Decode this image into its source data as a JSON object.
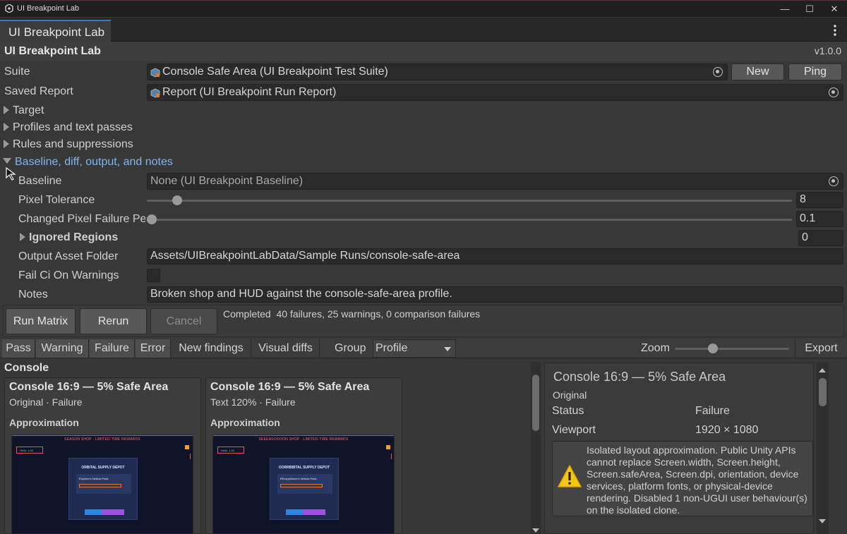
{
  "window": {
    "title": "UI Breakpoint Lab"
  },
  "tab": {
    "label": "UI Breakpoint Lab"
  },
  "header": {
    "title": "UI Breakpoint Lab",
    "version": "v1.0.0"
  },
  "suite": {
    "label": "Suite",
    "value": "Console Safe Area (UI Breakpoint Test Suite)",
    "new_label": "New",
    "ping_label": "Ping"
  },
  "saved_report": {
    "label": "Saved Report",
    "value": "Report (UI Breakpoint Run Report)"
  },
  "foldouts": {
    "target": "Target",
    "profiles": "Profiles and text passes",
    "rules": "Rules and suppressions",
    "baseline_section": "Baseline, diff, output, and notes"
  },
  "baseline": {
    "label": "Baseline",
    "value": "None (UI Breakpoint Baseline)"
  },
  "pixel_tolerance": {
    "label": "Pixel Tolerance",
    "value": "8",
    "fraction": 0.04
  },
  "changed_pixel": {
    "label": "Changed Pixel Failure Pe",
    "value": "0.1",
    "fraction": 0.0
  },
  "ignored_regions": {
    "label": "Ignored Regions",
    "count": "0"
  },
  "output_folder": {
    "label": "Output Asset Folder",
    "value": "Assets/UIBreakpointLabData/Sample Runs/console-safe-area"
  },
  "fail_ci": {
    "label": "Fail Ci On Warnings",
    "checked": false
  },
  "notes": {
    "label": "Notes",
    "value": "Broken shop and HUD against the console-safe-area profile."
  },
  "run": {
    "run_matrix": "Run Matrix",
    "rerun": "Rerun",
    "cancel": "Cancel",
    "status": "Completed  40 failures, 25 warnings, 0 comparison failures"
  },
  "filters": {
    "pass": "Pass",
    "warning": "Warning",
    "failure": "Failure",
    "error": "Error",
    "new_findings": "New findings",
    "visual_diffs": "Visual diffs",
    "group_label": "Group",
    "group_value": "Profile",
    "zoom_label": "Zoom",
    "zoom_fraction": 0.32,
    "export": "Export"
  },
  "results": {
    "section": "Console",
    "cards": [
      {
        "title": "Console 16:9 — 5% Safe Area",
        "subtitle": "Original · Failure",
        "approx": "Approximation",
        "thumb": {
          "banner": "SEASON SHOP - LIMITED-TIME REWARDS",
          "hud": "Hello, 1:00",
          "modal_title": "ORBITAL SUPPLY DEPOT",
          "inner_title": "Explorer's Nebula Pack"
        }
      },
      {
        "title": "Console 16:9 — 5% Safe Area",
        "subtitle": "Text 120% · Failure",
        "approx": "Approximation",
        "thumb": {
          "banner": "SEEEASOOOON SHOP - LIMITED-TIME REWARDS",
          "hud": "Hello, 1:00",
          "modal_title": "OORRBBITAL SUPPLY DEPOT",
          "inner_title": "EExxpplloorer's Nebula Pack"
        }
      }
    ]
  },
  "detail": {
    "title": "Console 16:9 — 5% Safe Area",
    "variant": "Original",
    "status_label": "Status",
    "status_value": "Failure",
    "viewport_label": "Viewport",
    "viewport_value": "1920 × 1080",
    "warning": "Isolated layout approximation. Public Unity APIs cannot replace Screen.width, Screen.height, Screen.safeArea, Screen.dpi, orientation, device services, platform fonts, or physical-device rendering. Disabled 1 non-UGUI user behaviour(s) on the isolated clone."
  },
  "colors": {
    "accent": "#3a79bb",
    "foldout_open": "#7fb4ee",
    "warning": "#f5c518"
  }
}
